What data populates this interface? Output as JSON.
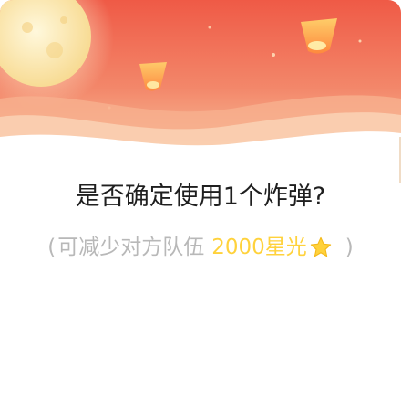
{
  "dialog": {
    "question": "是否确定使用1个炸弹?",
    "sub": {
      "open_paren": "(",
      "text": "可减少对方队伍",
      "amount": "2000星光",
      "close_paren": ")"
    },
    "icons": {
      "banner_decoration": "moon-and-lanterns-illustration",
      "currency": "star-icon"
    },
    "colors": {
      "banner_top": "#f0604a",
      "banner_bottom": "#f6c49a",
      "amount": "#ffd23c",
      "star": "#ffd23c",
      "question_text": "#1f1f1f",
      "muted_text": "#b8b8b8"
    }
  }
}
